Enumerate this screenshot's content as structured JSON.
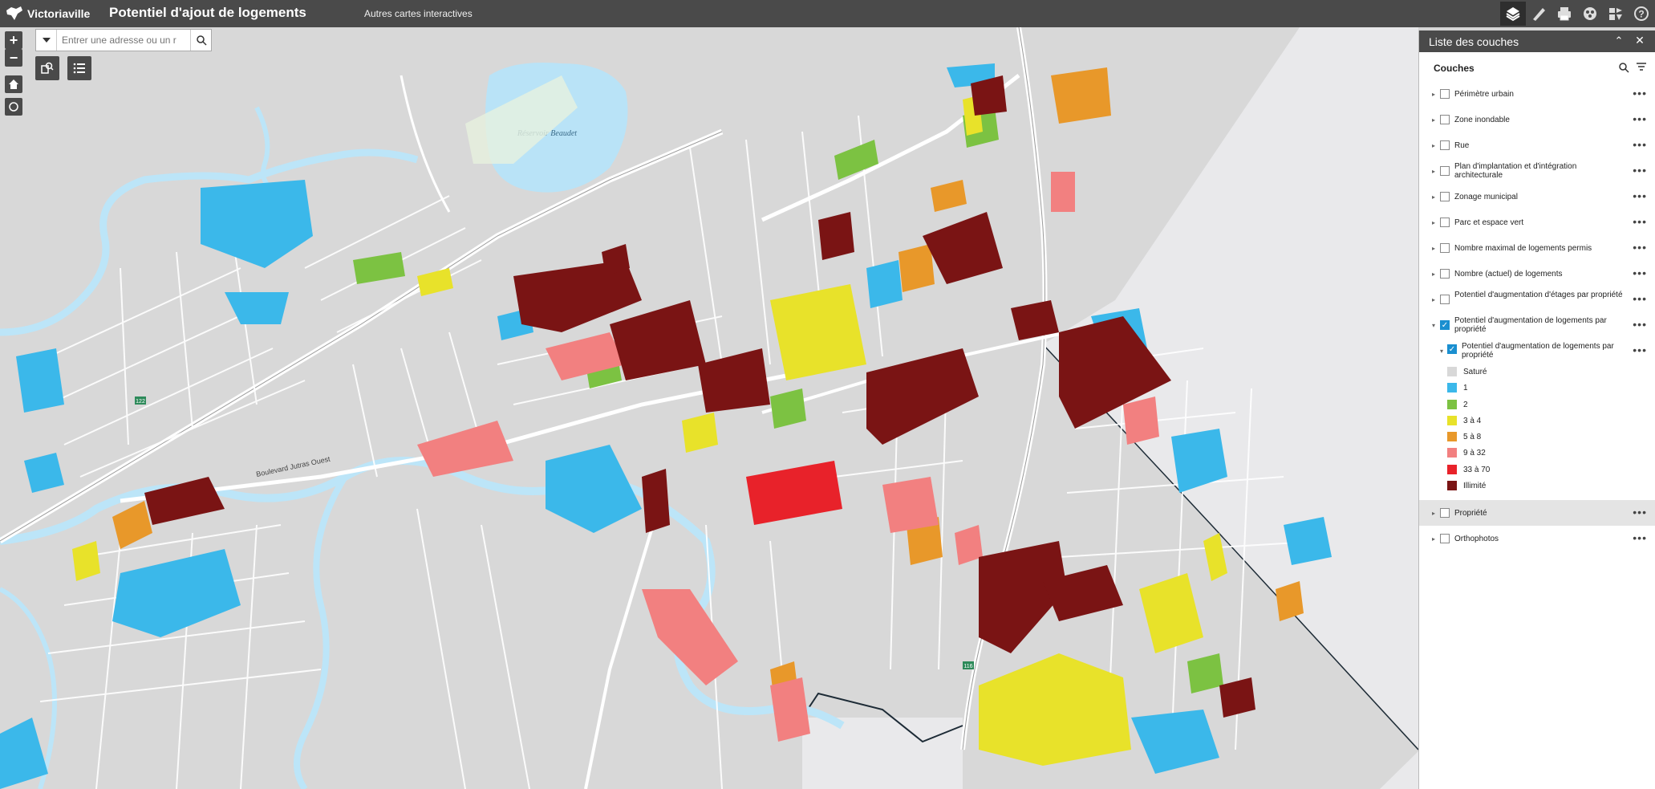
{
  "header": {
    "logo_text": "Victoriaville",
    "title": "Potentiel d'ajout de logements",
    "other_maps": "Autres cartes interactives",
    "tools": [
      "layers-icon",
      "measure-icon",
      "print-icon",
      "basemap-icon",
      "analysis-icon",
      "help-icon"
    ]
  },
  "search": {
    "placeholder": "Entrer une adresse ou un r"
  },
  "map_labels": {
    "reservoir": "Réservoir Beaudet",
    "road_122": "122",
    "road_116": "116",
    "bd_jutras": "Boulevard Jutras Ouest"
  },
  "panel": {
    "title": "Liste des couches",
    "subtitle": "Couches",
    "layers": [
      {
        "label": "Périmètre urbain",
        "checked": false
      },
      {
        "label": "Zone inondable",
        "checked": false
      },
      {
        "label": "Rue",
        "checked": false
      },
      {
        "label": "Plan d'implantation et d'intégration architecturale",
        "checked": false
      },
      {
        "label": "Zonage municipal",
        "checked": false
      },
      {
        "label": "Parc et espace vert",
        "checked": false
      },
      {
        "label": "Nombre maximal de logements permis",
        "checked": false
      },
      {
        "label": "Nombre (actuel) de logements",
        "checked": false
      },
      {
        "label": "Potentiel d'augmentation d'étages par propriété",
        "checked": false
      },
      {
        "label": "Potentiel d'augmentation de logements par propriété",
        "checked": true
      }
    ],
    "sublayer": {
      "label": "Potentiel d'augmentation de logements par propriété",
      "checked": true
    },
    "legend": [
      {
        "label": "Saturé",
        "color": "#d8d8d8"
      },
      {
        "label": "1",
        "color": "#3bb8ea"
      },
      {
        "label": "2",
        "color": "#7cc242"
      },
      {
        "label": "3 à 4",
        "color": "#e8e22a"
      },
      {
        "label": "5 à 8",
        "color": "#e8982a"
      },
      {
        "label": "9 à 32",
        "color": "#f28080"
      },
      {
        "label": "33 à 70",
        "color": "#e8222a"
      },
      {
        "label": "Illimité",
        "color": "#7a1414"
      }
    ],
    "after_layers": [
      {
        "label": "Propriété",
        "checked": false,
        "highlight": true
      },
      {
        "label": "Orthophotos",
        "checked": false,
        "highlight": false
      }
    ]
  }
}
